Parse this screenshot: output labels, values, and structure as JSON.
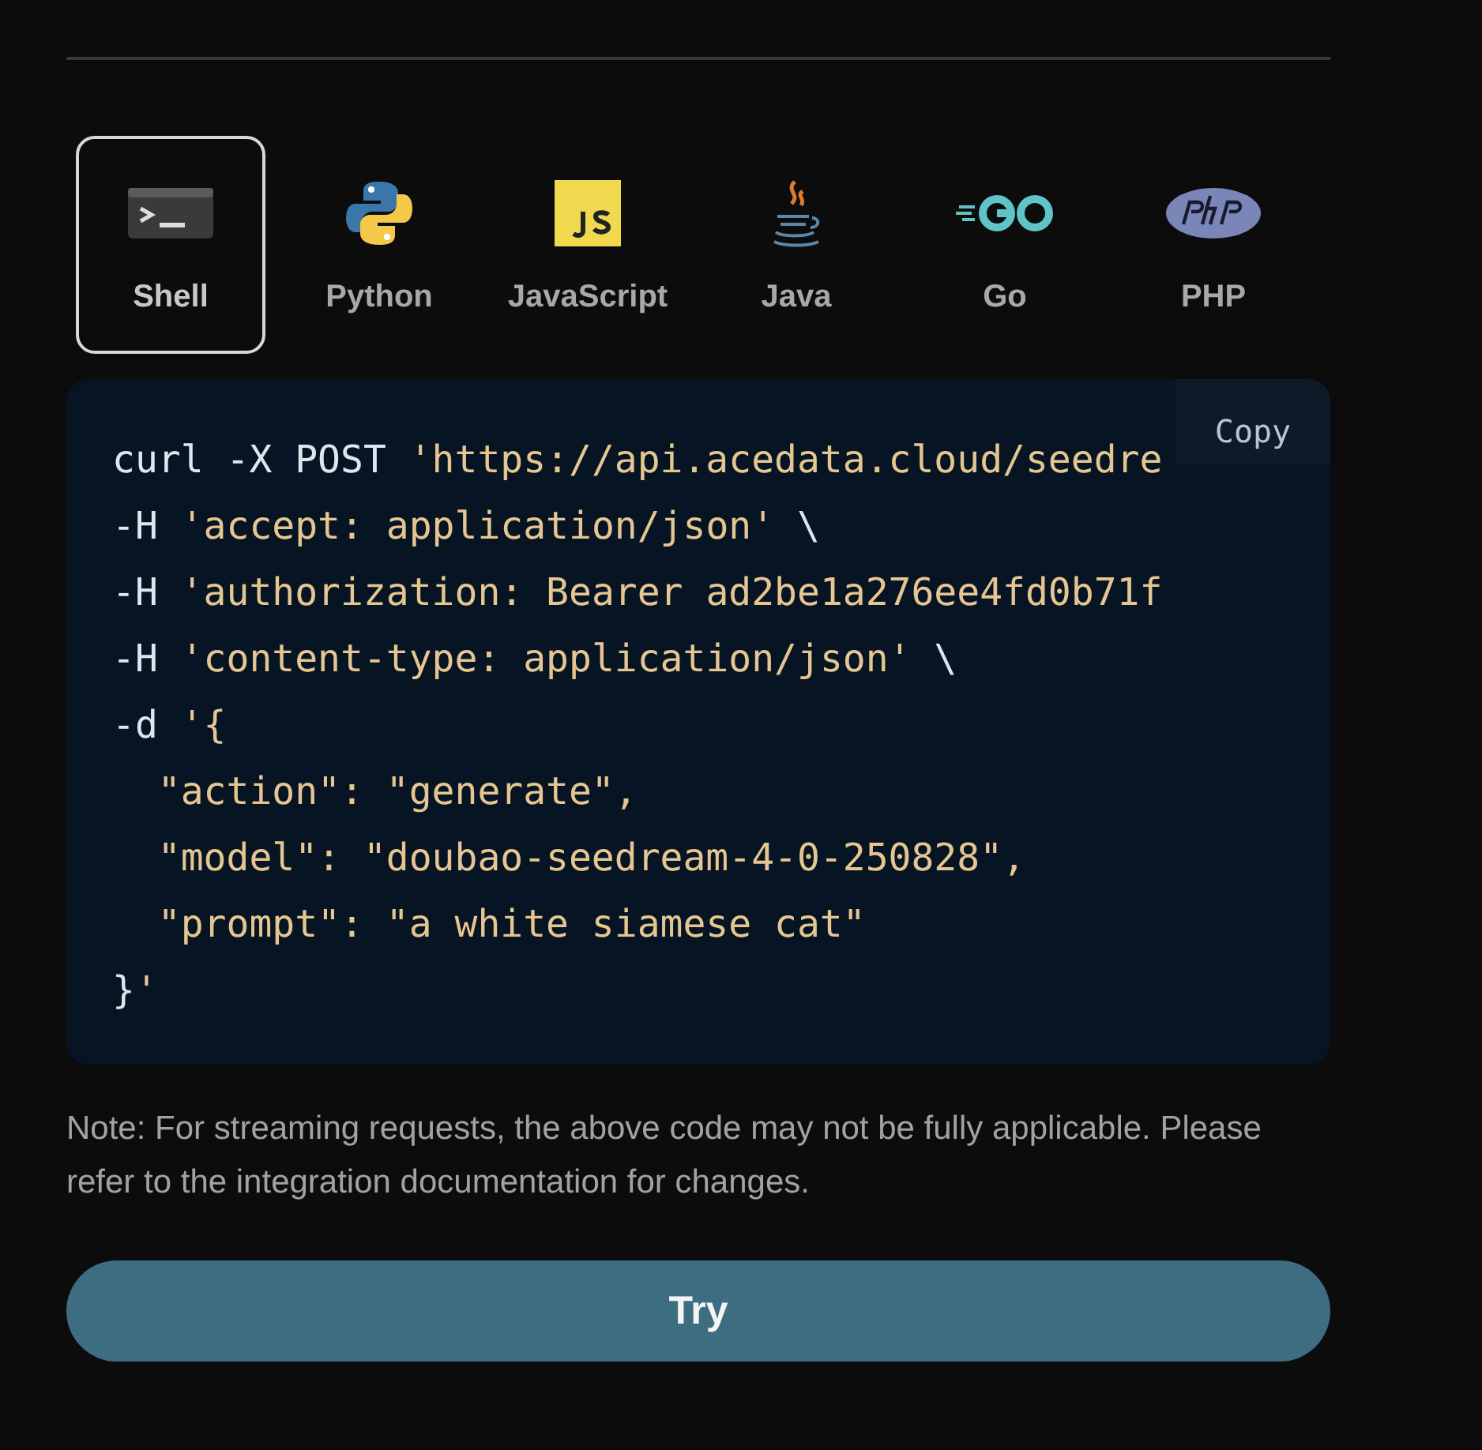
{
  "languages": [
    {
      "label": "Shell",
      "kind": "shell",
      "selected": true
    },
    {
      "label": "Python",
      "kind": "python",
      "selected": false
    },
    {
      "label": "JavaScript",
      "kind": "javascript",
      "selected": false
    },
    {
      "label": "Java",
      "kind": "java",
      "selected": false
    },
    {
      "label": "Go",
      "kind": "go",
      "selected": false
    },
    {
      "label": "PHP",
      "kind": "php",
      "selected": false
    }
  ],
  "code": {
    "copy_label": "Copy",
    "lines": [
      [
        {
          "kind": "plain",
          "text": "curl -X POST "
        },
        {
          "kind": "string",
          "text": "'https://api.acedata.cloud/seedre"
        }
      ],
      [
        {
          "kind": "plain",
          "text": "-H "
        },
        {
          "kind": "string",
          "text": "'accept: application/json'"
        },
        {
          "kind": "plain",
          "text": " \\"
        }
      ],
      [
        {
          "kind": "plain",
          "text": "-H "
        },
        {
          "kind": "string",
          "text": "'authorization: Bearer ad2be1a276ee4fd0b71f"
        }
      ],
      [
        {
          "kind": "plain",
          "text": "-H "
        },
        {
          "kind": "string",
          "text": "'content-type: application/json'"
        },
        {
          "kind": "plain",
          "text": " \\"
        }
      ],
      [
        {
          "kind": "plain",
          "text": "-d "
        },
        {
          "kind": "string",
          "text": "'{"
        }
      ],
      [
        {
          "kind": "string",
          "text": "  \"action\": \"generate\","
        }
      ],
      [
        {
          "kind": "string",
          "text": "  \"model\": \"doubao-seedream-4-0-250828\","
        }
      ],
      [
        {
          "kind": "string",
          "text": "  \"prompt\": \"a white siamese cat\""
        }
      ],
      [
        {
          "kind": "plain",
          "text": "}"
        },
        {
          "kind": "string",
          "text": "'"
        }
      ]
    ]
  },
  "note": "Note: For streaming requests, the above code may not be fully applicable. Please refer to the integration documentation for changes.",
  "try_button": "Try"
}
